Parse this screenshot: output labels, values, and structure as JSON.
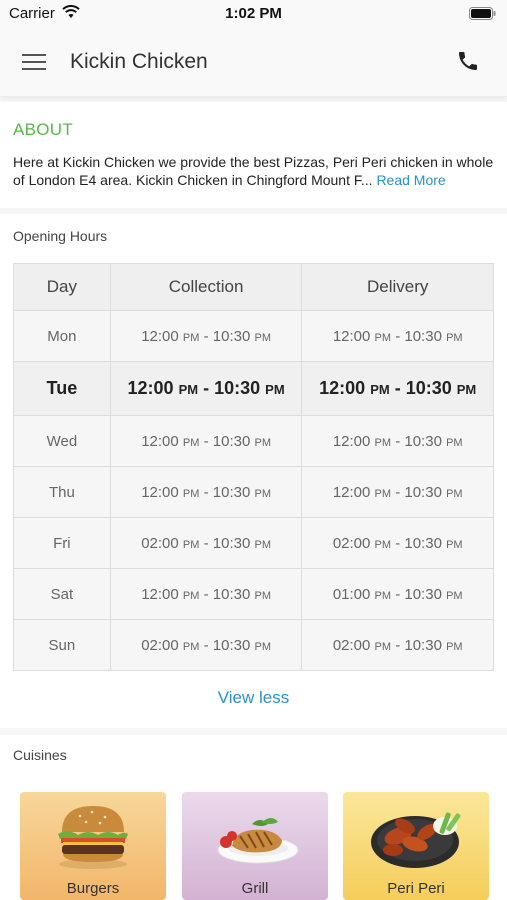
{
  "status_bar": {
    "carrier": "Carrier",
    "time": "1:02 PM"
  },
  "nav": {
    "title": "Kickin Chicken"
  },
  "about": {
    "title": "ABOUT",
    "text": "Here at Kickin Chicken we provide the best Pizzas, Peri Peri chicken in whole of London E4 area. Kickin Chicken in Chingford Mount F...",
    "read_more": "Read More"
  },
  "hours": {
    "title": "Opening Hours",
    "headers": {
      "day": "Day",
      "collection": "Collection",
      "delivery": "Delivery"
    },
    "rows": [
      {
        "day": "Mon",
        "collection": {
          "open": "12:00",
          "open_ampm": "PM",
          "close": "10:30",
          "close_ampm": "PM"
        },
        "delivery": {
          "open": "12:00",
          "open_ampm": "PM",
          "close": "10:30",
          "close_ampm": "PM"
        }
      },
      {
        "day": "Tue",
        "collection": {
          "open": "12:00",
          "open_ampm": "PM",
          "close": "10:30",
          "close_ampm": "PM"
        },
        "delivery": {
          "open": "12:00",
          "open_ampm": "PM",
          "close": "10:30",
          "close_ampm": "PM"
        }
      },
      {
        "day": "Wed",
        "collection": {
          "open": "12:00",
          "open_ampm": "PM",
          "close": "10:30",
          "close_ampm": "PM"
        },
        "delivery": {
          "open": "12:00",
          "open_ampm": "PM",
          "close": "10:30",
          "close_ampm": "PM"
        }
      },
      {
        "day": "Thu",
        "collection": {
          "open": "12:00",
          "open_ampm": "PM",
          "close": "10:30",
          "close_ampm": "PM"
        },
        "delivery": {
          "open": "12:00",
          "open_ampm": "PM",
          "close": "10:30",
          "close_ampm": "PM"
        }
      },
      {
        "day": "Fri",
        "collection": {
          "open": "02:00",
          "open_ampm": "PM",
          "close": "10:30",
          "close_ampm": "PM"
        },
        "delivery": {
          "open": "02:00",
          "open_ampm": "PM",
          "close": "10:30",
          "close_ampm": "PM"
        }
      },
      {
        "day": "Sat",
        "collection": {
          "open": "12:00",
          "open_ampm": "PM",
          "close": "10:30",
          "close_ampm": "PM"
        },
        "delivery": {
          "open": "01:00",
          "open_ampm": "PM",
          "close": "10:30",
          "close_ampm": "PM"
        }
      },
      {
        "day": "Sun",
        "collection": {
          "open": "02:00",
          "open_ampm": "PM",
          "close": "10:30",
          "close_ampm": "PM"
        },
        "delivery": {
          "open": "02:00",
          "open_ampm": "PM",
          "close": "10:30",
          "close_ampm": "PM"
        }
      }
    ],
    "highlighted_day": "Tue",
    "view_less": "View less"
  },
  "cuisines": {
    "title": "Cuisines",
    "items": [
      {
        "label": "Burgers",
        "icon": "burger-icon"
      },
      {
        "label": "Grill",
        "icon": "grill-icon"
      },
      {
        "label": "Peri Peri",
        "icon": "chicken-wings-icon"
      }
    ]
  },
  "colors": {
    "accent_green": "#55b84c",
    "link_blue": "#2a90c8"
  }
}
